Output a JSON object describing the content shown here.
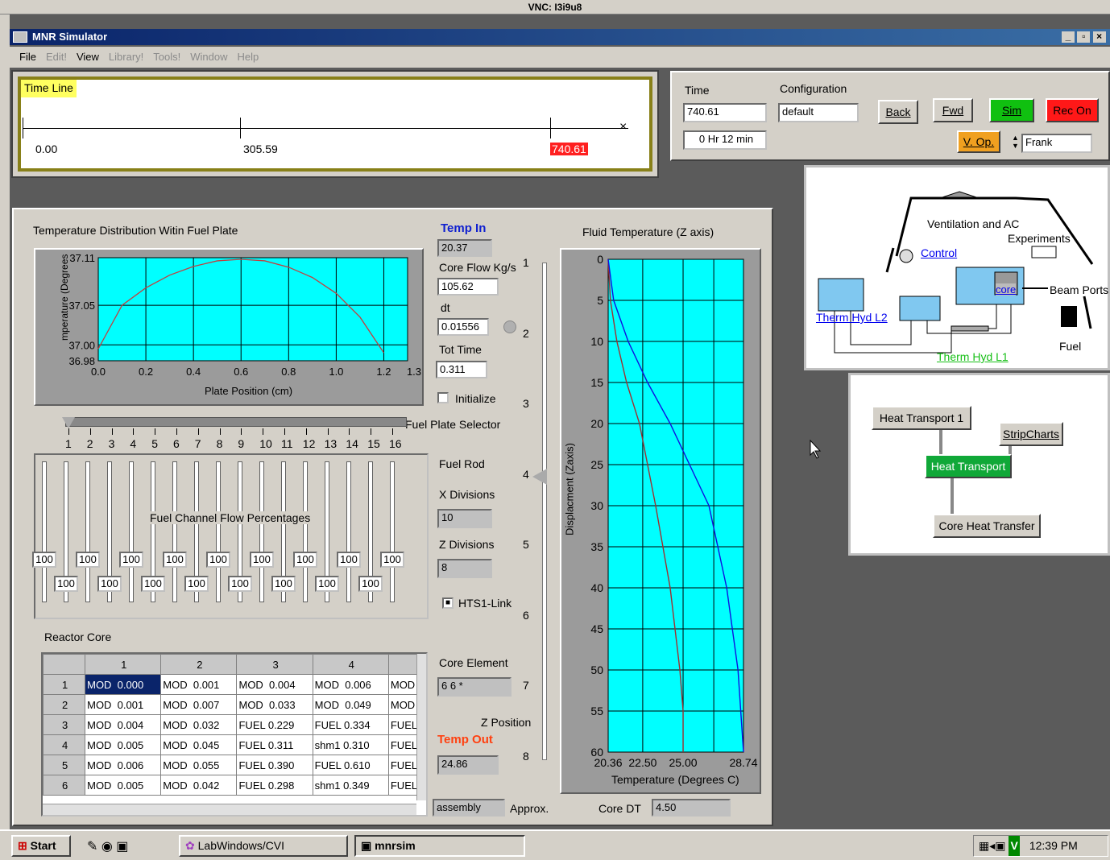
{
  "vnc_title": "VNC: I3i9u8",
  "app": {
    "title": "MNR Simulator",
    "menu": [
      "File",
      "Edit!",
      "View",
      "Library!",
      "Tools!",
      "Window",
      "Help"
    ],
    "menu_disabled": [
      false,
      true,
      false,
      true,
      true,
      true,
      true
    ]
  },
  "timeline": {
    "label": "Time Line",
    "t0": "0.00",
    "t1": "305.59",
    "t2": "740.61"
  },
  "controls": {
    "time_label": "Time",
    "time_value": "740.61",
    "elapsed": "0 Hr 12 min",
    "config_label": "Configuration",
    "config_value": "default",
    "back": "Back",
    "fwd": "Fwd",
    "sim": "Sim",
    "rec_on": "Rec On",
    "v_op": "V. Op.",
    "user": "Frank"
  },
  "schematic": {
    "ventilation": "Ventilation and AC",
    "experiments": "Experiments",
    "control": "Control",
    "core": "core",
    "beam_ports": "Beam Ports",
    "therm_l2": "Therm Hyd L2",
    "therm_l1": "Therm Hyd L1",
    "fuel": "Fuel"
  },
  "heat_nav": {
    "ht1": "Heat Transport 1",
    "strip": "StripCharts",
    "ht": "Heat Transport",
    "cht": "Core Heat Transfer"
  },
  "fuel_plate": {
    "title": "Temperature Distribution Witin Fuel Plate",
    "ylabel": "mperature (Degrees",
    "xlabel": "Plate Position (cm)",
    "yticks": [
      "37.11",
      "37.05",
      "37.00",
      "36.98"
    ],
    "xticks": [
      "0.0",
      "0.2",
      "0.4",
      "0.6",
      "0.8",
      "1.0",
      "1.2",
      "1.3"
    ]
  },
  "params": {
    "temp_in_label": "Temp In",
    "temp_in": "20.37",
    "core_flow_label": "Core Flow Kg/s",
    "core_flow": "105.62",
    "dt_label": "dt",
    "dt": "0.01556",
    "tot_time_label": "Tot Time",
    "tot_time": "0.311",
    "initialize": "Initialize",
    "fuel_rod": "Fuel Rod",
    "x_div_label": "X Divisions",
    "x_div": "10",
    "z_div_label": "Z Divisions",
    "z_div": "8",
    "hts1": "HTS1-Link",
    "core_element_label": "Core Element",
    "core_element": "6 6 *",
    "z_pos_label": "Z Position",
    "temp_out_label": "Temp Out",
    "temp_out": "24.86",
    "assembly": "assembly",
    "approx": "Approx.",
    "core_dt_label": "Core DT",
    "core_dt": "4.50"
  },
  "selector": {
    "label": "Fuel Plate Selector",
    "nums": [
      "1",
      "2",
      "3",
      "4",
      "5",
      "6",
      "7",
      "8",
      "9",
      "10",
      "11",
      "12",
      "13",
      "14",
      "15",
      "16"
    ]
  },
  "flow": {
    "label": "Fuel Channel Flow Percentages",
    "value": "100"
  },
  "zscale": [
    "1",
    "2",
    "3",
    "4",
    "5",
    "6",
    "7",
    "8"
  ],
  "fluid": {
    "title": "Fluid Temperature (Z axis)",
    "ylabel": "Displacment (Zaxis)",
    "xlabel": "Temperature (Degrees C)",
    "yticks": [
      "0",
      "5",
      "10",
      "15",
      "20",
      "25",
      "30",
      "35",
      "40",
      "45",
      "50",
      "55",
      "60"
    ],
    "xticks": [
      "20.36",
      "22.50",
      "25.00",
      "28.74"
    ]
  },
  "core": {
    "label": "Reactor Core",
    "cols": [
      "",
      "1",
      "2",
      "3",
      "4",
      ""
    ],
    "rows": [
      [
        "1",
        "MOD  0.000",
        "MOD  0.001",
        "MOD  0.004",
        "MOD  0.006",
        "MOD"
      ],
      [
        "2",
        "MOD  0.001",
        "MOD  0.007",
        "MOD  0.033",
        "MOD  0.049",
        "MOD"
      ],
      [
        "3",
        "MOD  0.004",
        "MOD  0.032",
        "FUEL 0.229",
        "FUEL 0.334",
        "FUEL"
      ],
      [
        "4",
        "MOD  0.005",
        "MOD  0.045",
        "FUEL 0.311",
        "shm1 0.310",
        "FUEL"
      ],
      [
        "5",
        "MOD  0.006",
        "MOD  0.055",
        "FUEL 0.390",
        "FUEL 0.610",
        "FUEL"
      ],
      [
        "6",
        "MOD  0.005",
        "MOD  0.042",
        "FUEL 0.298",
        "shm1 0.349",
        "FUEL"
      ]
    ]
  },
  "taskbar": {
    "start": "Start",
    "labwindows": "LabWindows/CVI",
    "mnrsim": "mnrsim",
    "clock": "12:39 PM"
  },
  "chart_data": [
    {
      "type": "line",
      "title": "Temperature Distribution Witin Fuel Plate",
      "xlabel": "Plate Position (cm)",
      "ylabel": "mperature (Degrees",
      "xlim": [
        0,
        1.3
      ],
      "ylim": [
        36.98,
        37.11
      ],
      "series": [
        {
          "x": [
            0,
            0.1,
            0.2,
            0.3,
            0.4,
            0.5,
            0.6,
            0.7,
            0.8,
            0.9,
            1.0,
            1.1,
            1.2
          ],
          "y": [
            36.995,
            37.05,
            37.072,
            37.088,
            37.099,
            37.106,
            37.108,
            37.106,
            37.098,
            37.085,
            37.065,
            37.035,
            36.99
          ]
        }
      ]
    },
    {
      "type": "line",
      "title": "Fluid Temperature (Z axis)",
      "xlabel": "Temperature (Degrees C)",
      "ylabel": "Displacment (Zaxis)",
      "xlim": [
        20.36,
        28.74
      ],
      "ylim": [
        0,
        60
      ],
      "series": [
        {
          "x": [
            20.36,
            20.5,
            20.9,
            21.5,
            22.3,
            23.3,
            24.2,
            24.8,
            25.0,
            25.0
          ],
          "y": [
            0,
            5,
            10,
            15,
            20,
            30,
            40,
            50,
            55,
            60
          ]
        },
        {
          "x": [
            20.36,
            20.7,
            21.6,
            22.8,
            24.2,
            25.4,
            26.6,
            27.7,
            28.4,
            28.74
          ],
          "y": [
            0,
            5,
            10,
            15,
            20,
            25,
            30,
            40,
            50,
            60
          ]
        }
      ]
    }
  ]
}
